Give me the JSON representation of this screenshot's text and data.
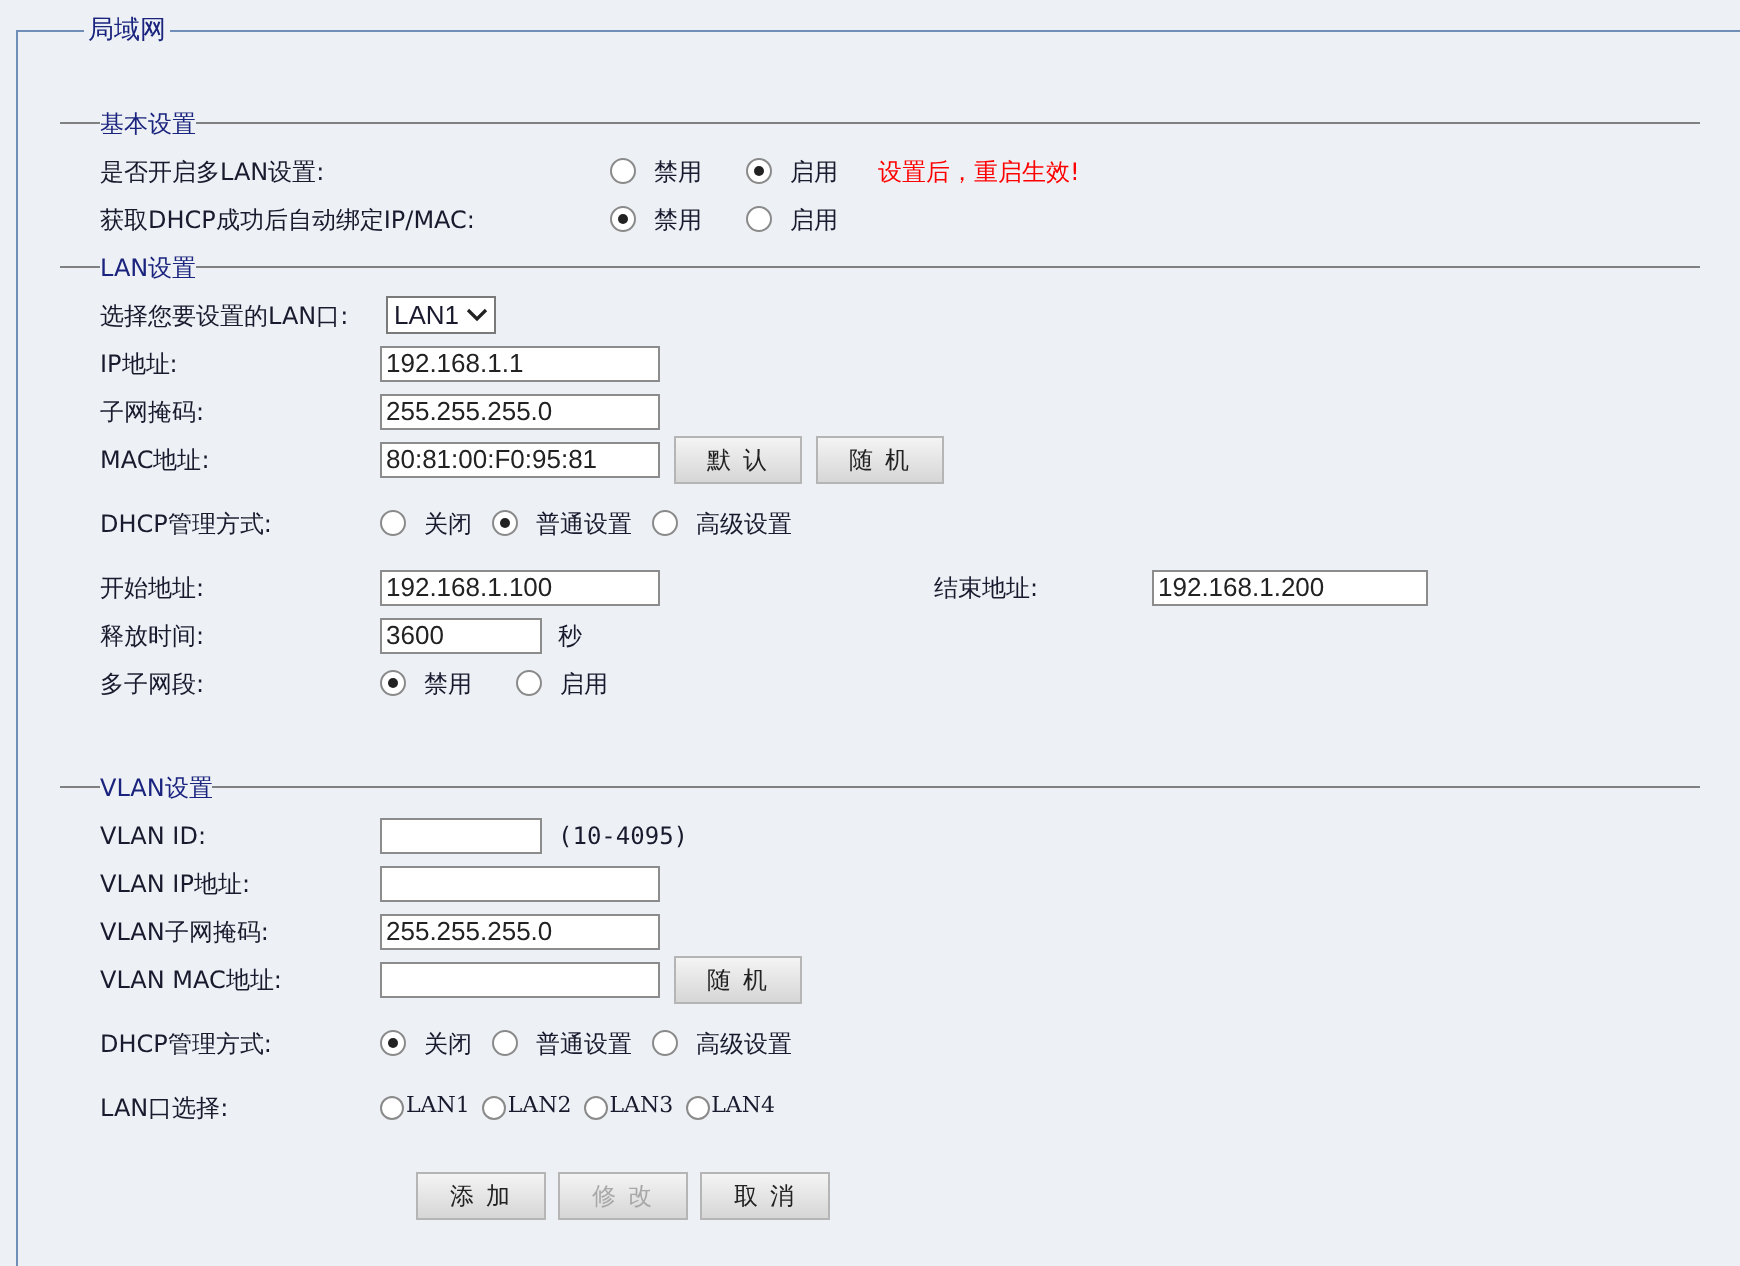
{
  "panel_title": "局域网",
  "sections": [
    {
      "title": "基本设置",
      "kind": "wide",
      "rows": [
        {
          "kind": "radio",
          "label": "是否开启多LAN设置:",
          "options": [
            {
              "label": "禁用",
              "selected": false
            },
            {
              "label": "启用",
              "selected": true
            }
          ],
          "note": "设置后，重启生效!"
        },
        {
          "kind": "radio",
          "label": "获取DHCP成功后自动绑定IP/MAC:",
          "options": [
            {
              "label": "禁用",
              "selected": true
            },
            {
              "label": "启用",
              "selected": false
            }
          ]
        }
      ]
    },
    {
      "title": "LAN设置",
      "kind": "narrow",
      "rows": [
        {
          "kind": "select",
          "label": "选择您要设置的LAN口:",
          "value": "LAN1"
        },
        {
          "kind": "input",
          "label": "IP地址:",
          "value": "192.168.1.1"
        },
        {
          "kind": "input",
          "label": "子网掩码:",
          "value": "255.255.255.0"
        },
        {
          "kind": "input",
          "label": "MAC地址:",
          "value": "80:81:00:F0:95:81",
          "buttons": [
            "默 认",
            "随 机"
          ]
        },
        {
          "kind": "mode",
          "label": "DHCP管理方式:",
          "options": [
            {
              "label": "关闭",
              "selected": false
            },
            {
              "label": "普通设置",
              "selected": true
            },
            {
              "label": "高级设置",
              "selected": false
            }
          ]
        },
        {
          "kind": "pair",
          "label": "开始地址:",
          "value": "192.168.1.100",
          "label_2": "结束地址:",
          "value_2": "192.168.1.200"
        },
        {
          "kind": "input",
          "label": "释放时间:",
          "value": "3600",
          "suffix": "秒"
        },
        {
          "kind": "radio",
          "label": "多子网段:",
          "options": [
            {
              "label": "禁用",
              "selected": true
            },
            {
              "label": "启用",
              "selected": false
            }
          ]
        }
      ]
    },
    {
      "title": "VLAN设置",
      "kind": "narrow",
      "rows": [
        {
          "kind": "input",
          "label": "VLAN ID:",
          "suffix": "(10-4095)"
        },
        {
          "kind": "input",
          "label": "VLAN IP地址:"
        },
        {
          "kind": "input",
          "label": "VLAN子网掩码:",
          "value": "255.255.255.0"
        },
        {
          "kind": "input",
          "label": "VLAN MAC地址:",
          "buttons": [
            "随 机"
          ]
        },
        {
          "kind": "mode",
          "label": "DHCP管理方式:",
          "options": [
            {
              "label": "关闭",
              "selected": true
            },
            {
              "label": "普通设置",
              "selected": false
            },
            {
              "label": "高级设置",
              "selected": false
            }
          ]
        },
        {
          "kind": "ports",
          "label": "LAN口选择:",
          "options": [
            {
              "label": "LAN1",
              "selected": false
            },
            {
              "label": "LAN2",
              "selected": false
            },
            {
              "label": "LAN3",
              "selected": false
            },
            {
              "label": "LAN4",
              "selected": false
            }
          ]
        }
      ]
    }
  ],
  "actions": [
    {
      "label": "添 加",
      "disabled": false
    },
    {
      "label": "修 改",
      "disabled": true
    },
    {
      "label": "取 消",
      "disabled": false
    }
  ]
}
